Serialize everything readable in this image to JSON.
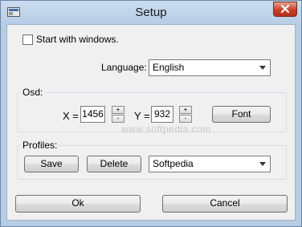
{
  "window": {
    "title": "Setup"
  },
  "general": {
    "start_with_windows_label": "Start with windows.",
    "start_with_windows_checked": false,
    "language_label": "Language:",
    "language_value": "English"
  },
  "osd": {
    "legend": "Osd:",
    "x_label": "X =",
    "x_value": "1456",
    "y_label": "Y =",
    "y_value": "932",
    "font_button": "Font"
  },
  "profiles": {
    "legend": "Profiles:",
    "save_button": "Save",
    "delete_button": "Delete",
    "profile_value": "Softpedia"
  },
  "watermark": "www.softpedia.com",
  "footer": {
    "ok_button": "Ok",
    "cancel_button": "Cancel"
  }
}
